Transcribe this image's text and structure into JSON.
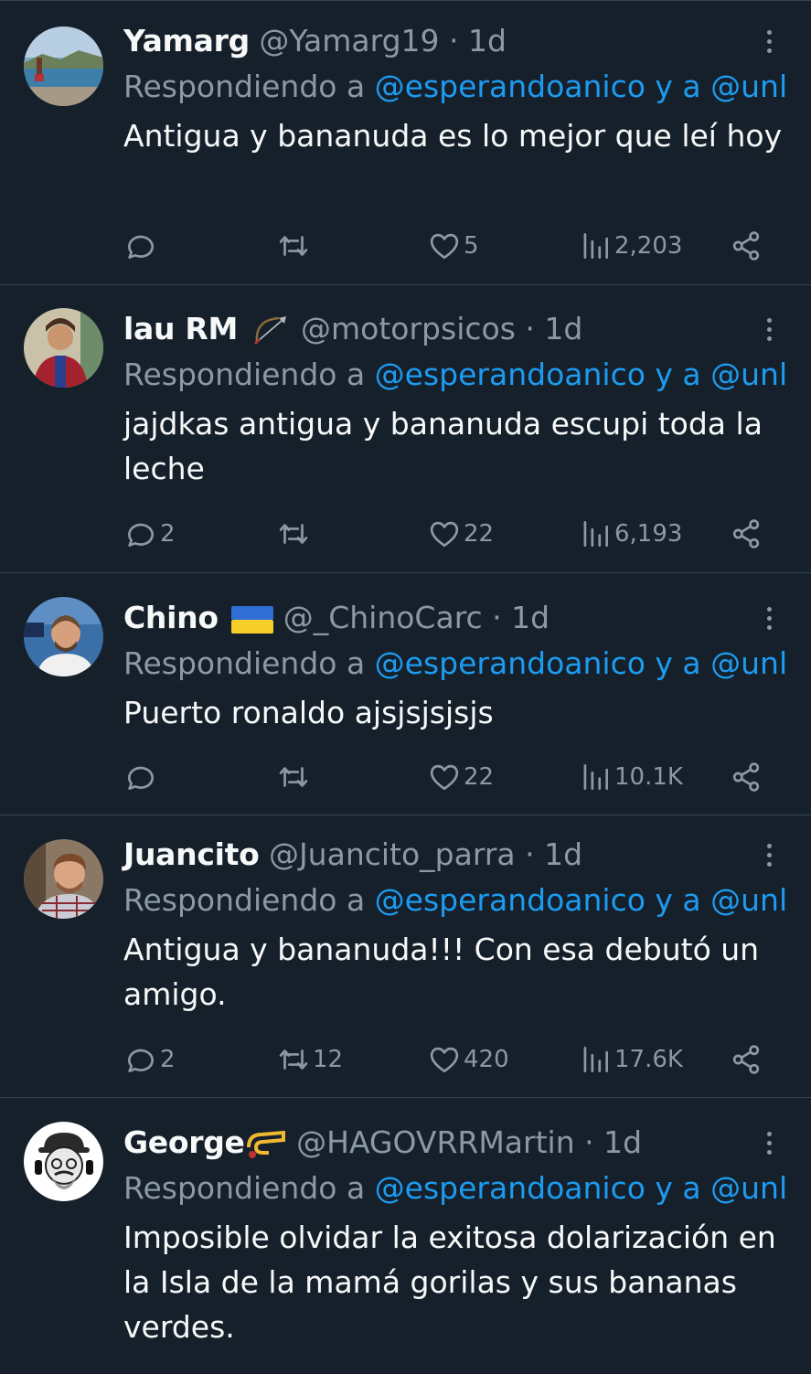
{
  "reply_prefix": "Respondiendo a ",
  "reply_mentions": "@esperandoanico y a @unl",
  "tweets": [
    {
      "name": "Yamarg",
      "handle": "@Yamarg19",
      "dot": " · ",
      "time": "1d",
      "text": "Antigua y bananuda es lo mejor que leí hoy",
      "replies": "",
      "retweets": "",
      "likes": "5",
      "views": "2,203"
    },
    {
      "name": "lau RM",
      "handle": "@motorpsicos",
      "dot": " · ",
      "time": "1d",
      "text": "jajdkas antigua y bananuda escupi toda la leche",
      "replies": "2",
      "retweets": "",
      "likes": "22",
      "views": "6,193"
    },
    {
      "name": "Chino",
      "handle": "@_ChinoCarc",
      "dot": " · ",
      "time": "1d",
      "text": "Puerto ronaldo ajsjsjsjsjs",
      "replies": "",
      "retweets": "",
      "likes": "22",
      "views": "10.1K"
    },
    {
      "name": "Juancito",
      "handle": "@Juancito_parra",
      "dot": " · ",
      "time": "1d",
      "text": "Antigua y bananuda!!! Con esa debutó un amigo.",
      "replies": "2",
      "retweets": "12",
      "likes": "420",
      "views": "17.6K"
    },
    {
      "name": "George",
      "handle": "@HAGOVRRMartin",
      "dot": " · ",
      "time": "1d",
      "text": "Imposible olvidar la exitosa dolarización en la Isla de la mamá gorilas y sus bananas verdes.",
      "replies": "",
      "retweets": "",
      "likes": "",
      "views": ""
    }
  ],
  "icons": {
    "reply": "reply-icon",
    "retweet": "retweet-icon",
    "like": "heart-icon",
    "views": "views-icon",
    "share": "share-icon",
    "more": "more-icon"
  },
  "colors": {
    "background": "#15202b",
    "separator": "#38444d",
    "secondary_text": "#8b98a5",
    "mention": "#1d9bf0",
    "primary_text": "#f7f9f9"
  }
}
